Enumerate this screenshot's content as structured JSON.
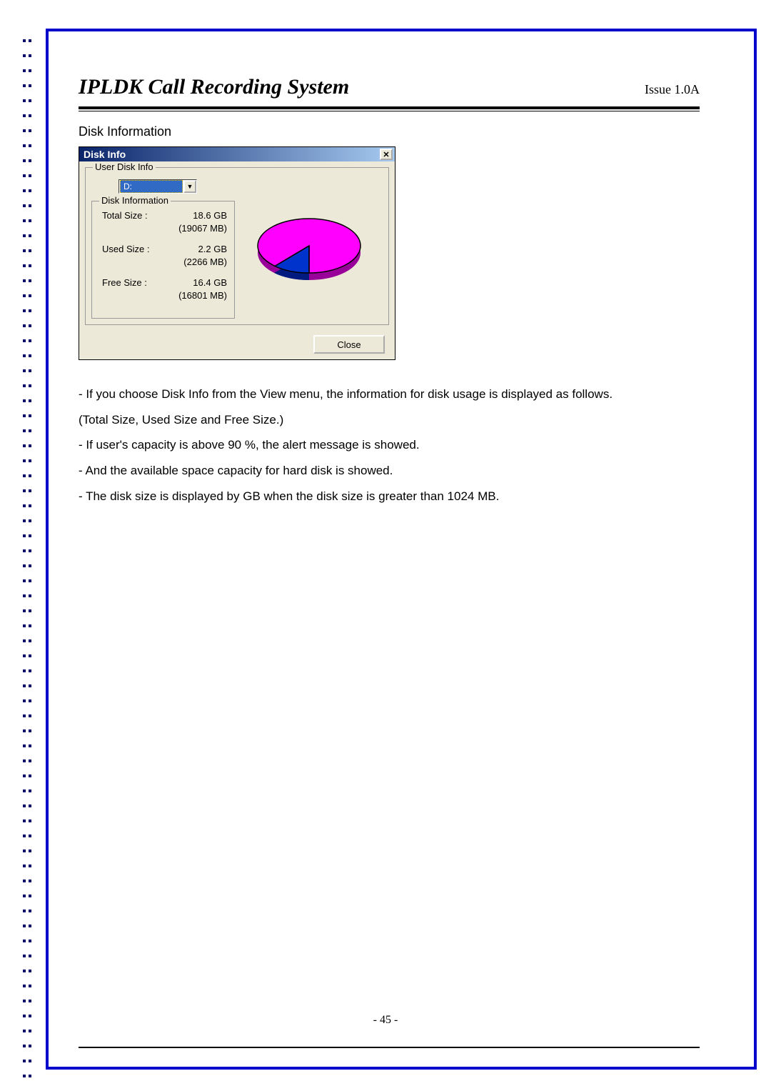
{
  "header": {
    "title": "IPLDK Call Recording System",
    "issue": "Issue 1.0A"
  },
  "section_title": "Disk Information",
  "dialog": {
    "title": "Disk Info",
    "group_outer": "User Disk Info",
    "drive_selected": "D:",
    "group_inner": "Disk Information",
    "rows": {
      "total": {
        "label": "Total Size :",
        "gb": "18.6 GB",
        "mb": "(19067 MB)"
      },
      "used": {
        "label": "Used Size :",
        "gb": "2.2 GB",
        "mb": "(2266 MB)"
      },
      "free": {
        "label": "Free Size :",
        "gb": "16.4 GB",
        "mb": "(16801 MB)"
      }
    },
    "close": "Close"
  },
  "chart_data": {
    "type": "pie",
    "title": "",
    "series": [
      {
        "name": "Used Size",
        "value": 2266,
        "color": "#0033cc"
      },
      {
        "name": "Free Size",
        "value": 16801,
        "color": "#ff00ff"
      }
    ],
    "total": 19067,
    "unit": "MB"
  },
  "body_lines": [
    "- If you choose Disk Info from the View menu, the information for disk usage is displayed as follows.",
    "(Total Size, Used Size and Free Size.)",
    "- If user's capacity is above 90 %, the alert message is showed.",
    "- And the available space capacity for hard disk is showed.",
    "- The disk size is displayed by GB when the disk size is greater than 1024 MB."
  ],
  "page_num": "- 45 -"
}
